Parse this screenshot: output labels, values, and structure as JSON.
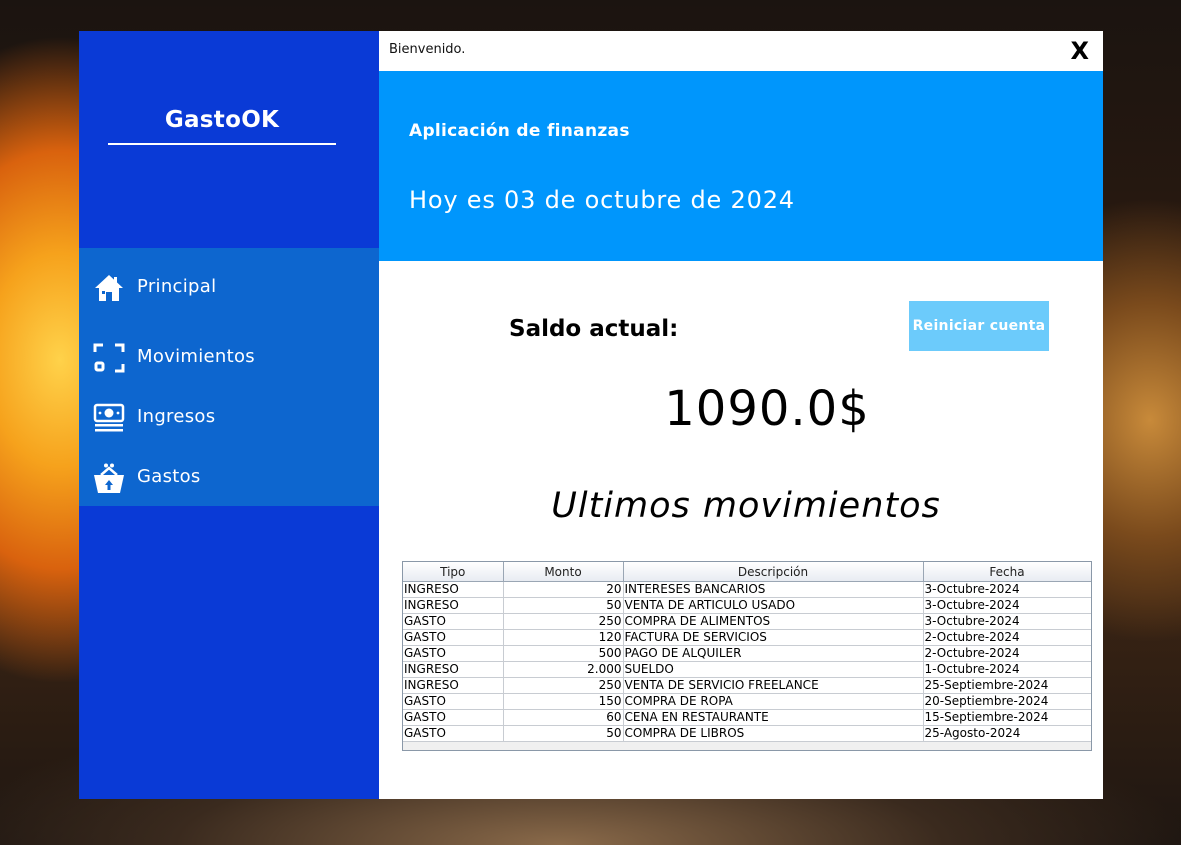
{
  "app": {
    "brand": "GastoOK",
    "title": "Bienvenido.",
    "close_label": "X"
  },
  "sidebar": {
    "items": [
      {
        "label": "Principal",
        "icon": "home-icon"
      },
      {
        "label": "Movimientos",
        "icon": "scan-frame-icon"
      },
      {
        "label": "Ingresos",
        "icon": "money-stack-icon"
      },
      {
        "label": "Gastos",
        "icon": "basket-icon"
      }
    ]
  },
  "header": {
    "subtitle": "Aplicación de finanzas",
    "date_text": "Hoy es 03 de octubre de 2024"
  },
  "balance": {
    "label": "Saldo actual:",
    "value": "1090.0$",
    "reset_label": "Reiniciar cuenta"
  },
  "movements": {
    "title": "Ultimos movimientos",
    "columns": [
      "Tipo",
      "Monto",
      "Descripción",
      "Fecha"
    ],
    "rows": [
      [
        "INGRESO",
        "20",
        "INTERESES BANCARIOS",
        "3-Octubre-2024"
      ],
      [
        "INGRESO",
        "50",
        "VENTA DE ARTICULO USADO",
        "3-Octubre-2024"
      ],
      [
        "GASTO",
        "250",
        "COMPRA DE ALIMENTOS",
        "3-Octubre-2024"
      ],
      [
        "GASTO",
        "120",
        "FACTURA DE SERVICIOS",
        "2-Octubre-2024"
      ],
      [
        "GASTO",
        "500",
        "PAGO DE ALQUILER",
        "2-Octubre-2024"
      ],
      [
        "INGRESO",
        "2.000",
        "SUELDO",
        "1-Octubre-2024"
      ],
      [
        "INGRESO",
        "250",
        "VENTA DE SERVICIO FREELANCE",
        "25-Septiembre-2024"
      ],
      [
        "GASTO",
        "150",
        "COMPRA DE ROPA",
        "20-Septiembre-2024"
      ],
      [
        "GASTO",
        "60",
        "CENA EN RESTAURANTE",
        "15-Septiembre-2024"
      ],
      [
        "GASTO",
        "50",
        "COMPRA DE LIBROS",
        "25-Agosto-2024"
      ]
    ]
  },
  "colors": {
    "sidebar_bg": "#0a3ad6",
    "nav_bg": "#0d66cf",
    "header_bg": "#0096fc",
    "reset_button_bg": "#6ccbfb"
  }
}
